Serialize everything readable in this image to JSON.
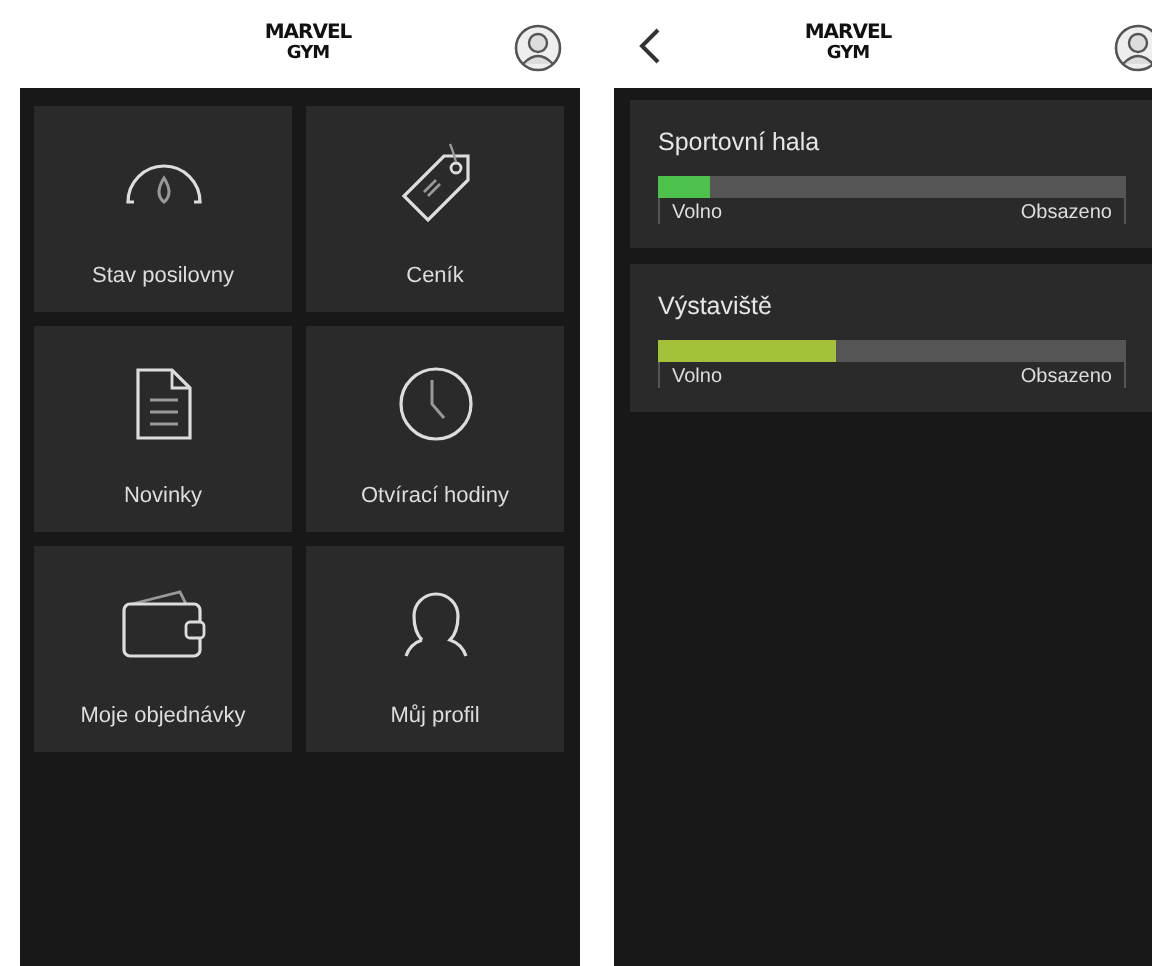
{
  "screens": [
    {
      "header": {
        "back": false,
        "logo": [
          "MARVEL",
          "GYM"
        ]
      },
      "tiles": [
        {
          "kind": "gauge",
          "label": "Stav posilovny"
        },
        {
          "kind": "tag",
          "label": "Ceník"
        },
        {
          "kind": "document",
          "label": "Novinky"
        },
        {
          "kind": "clock",
          "label": "Otvírací hodiny"
        },
        {
          "kind": "wallet",
          "label": "Moje objednávky"
        },
        {
          "kind": "person",
          "label": "Můj profil"
        }
      ]
    },
    {
      "header": {
        "back": true,
        "logo": [
          "MARVEL",
          "GYM"
        ]
      },
      "occupancy": [
        {
          "name": "Sportovní hala",
          "level": 0.11,
          "color": "#4cc24c",
          "low": "Volno",
          "high": "Obsazeno"
        },
        {
          "name": "Výstaviště",
          "level": 0.38,
          "color": "#a3c23a",
          "low": "Volno",
          "high": "Obsazeno"
        }
      ]
    }
  ]
}
